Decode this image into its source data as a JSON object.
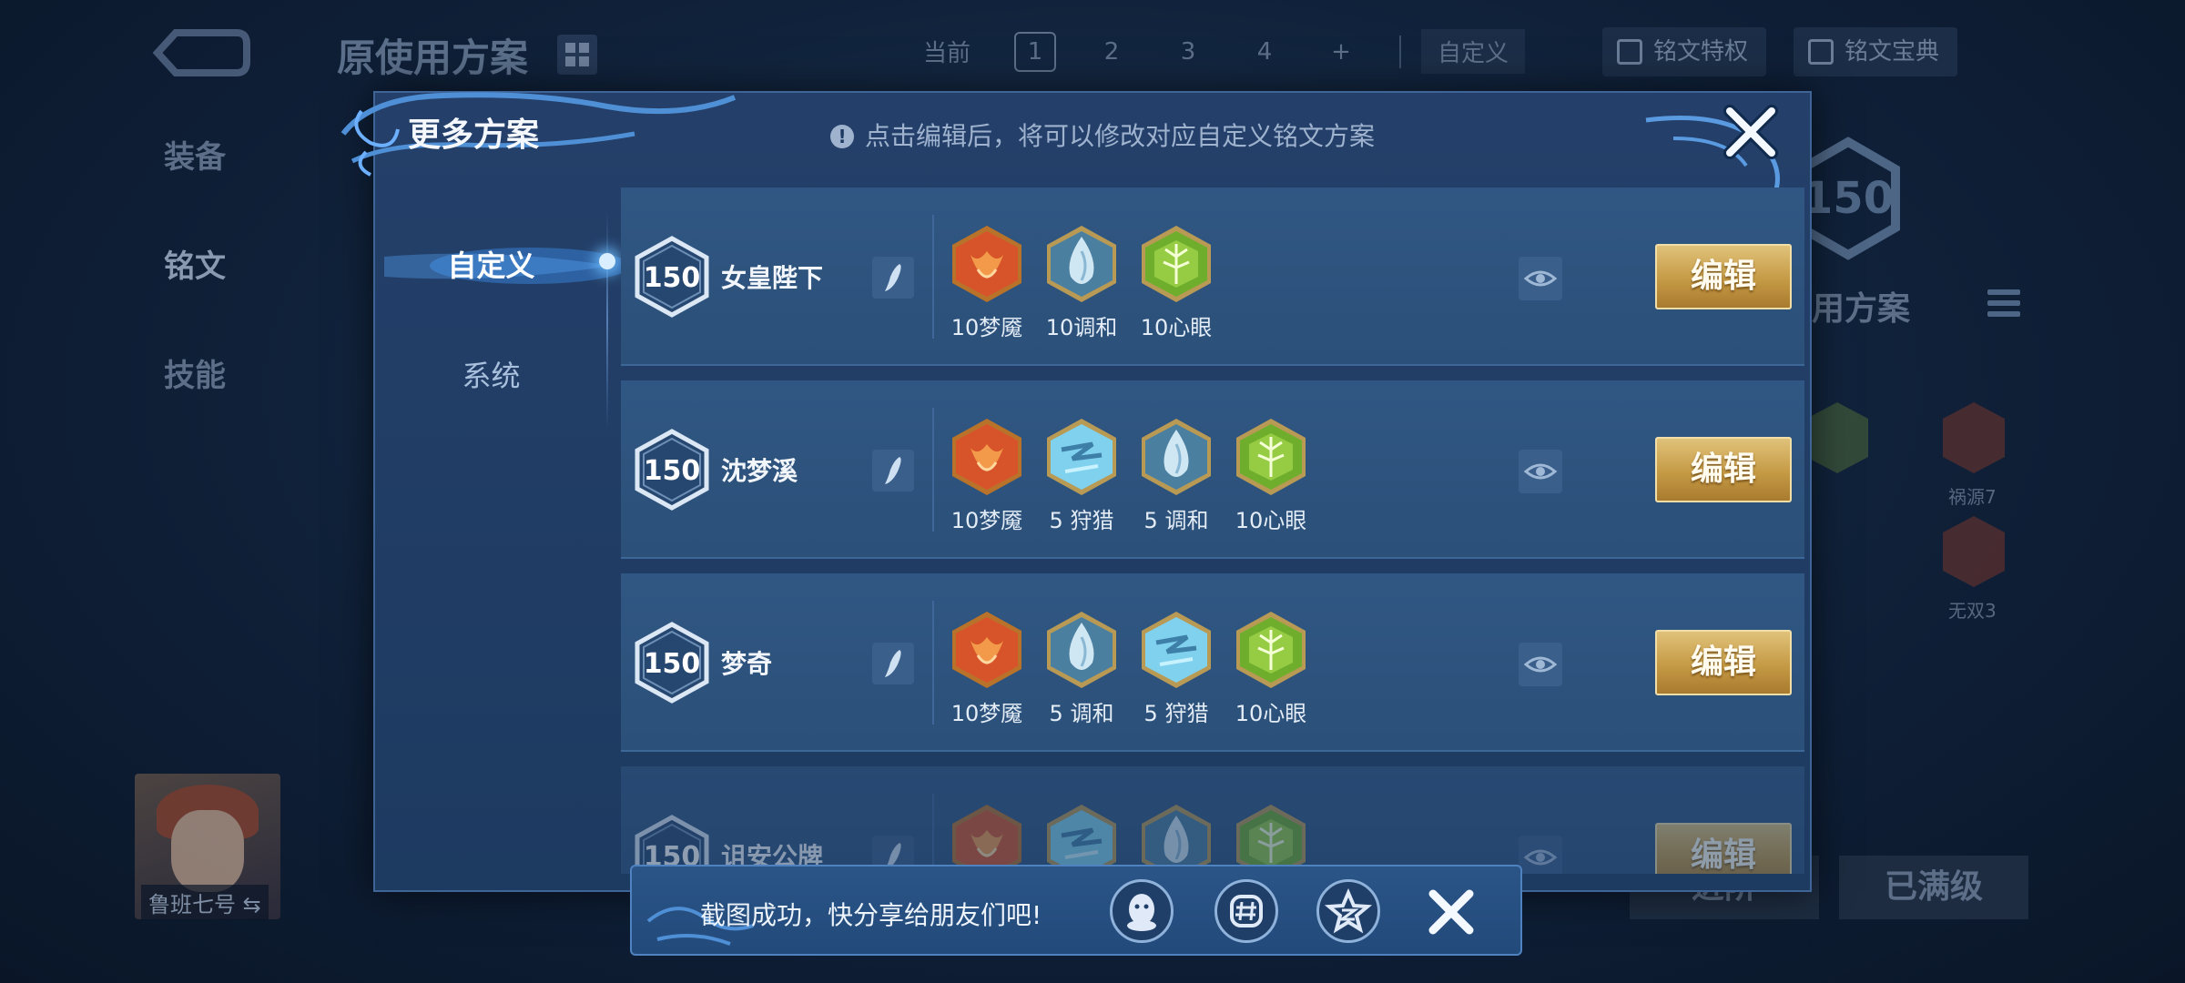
{
  "background": {
    "title": "原使用方案",
    "tabs": {
      "current_label": "当前",
      "pages": [
        "1",
        "2",
        "3",
        "4"
      ],
      "add": "+"
    },
    "custom_label": "自定义",
    "features": [
      "铭文特权",
      "铭文宝典"
    ],
    "side_nav": [
      "装备",
      "铭文",
      "技能"
    ],
    "badge_level": "150",
    "using_label": "用方案",
    "rune_labels": [
      "祸源7",
      "无双3"
    ],
    "hero_name": "鲁班七号 ⇆",
    "buttons": [
      "进阶",
      "已满级"
    ]
  },
  "modal": {
    "title": "更多方案",
    "hint": "点击编辑后，将可以修改对应自定义铭文方案",
    "tabs": {
      "custom": "自定义",
      "system": "系统"
    },
    "rows": [
      {
        "level": "150",
        "name": "女皇陛下",
        "edit_label": "编辑",
        "runes": [
          {
            "type": "red",
            "label": "10梦魇"
          },
          {
            "type": "blue",
            "label": "10调和"
          },
          {
            "type": "green",
            "label": "10心眼"
          }
        ]
      },
      {
        "level": "150",
        "name": "沈梦溪",
        "edit_label": "编辑",
        "runes": [
          {
            "type": "red",
            "label": "10梦魇"
          },
          {
            "type": "cyan",
            "label": "5 狩猎"
          },
          {
            "type": "blue",
            "label": "5 调和"
          },
          {
            "type": "green",
            "label": "10心眼"
          }
        ]
      },
      {
        "level": "150",
        "name": "梦奇",
        "edit_label": "编辑",
        "runes": [
          {
            "type": "red",
            "label": "10梦魇"
          },
          {
            "type": "blue",
            "label": "5 调和"
          },
          {
            "type": "cyan",
            "label": "5 狩猎"
          },
          {
            "type": "green",
            "label": "10心眼"
          }
        ]
      },
      {
        "level": "150",
        "name": "诅安公牌",
        "edit_label": "编辑",
        "runes": [
          {
            "type": "red",
            "label": ""
          },
          {
            "type": "cyan",
            "label": ""
          },
          {
            "type": "blue",
            "label": ""
          },
          {
            "type": "green",
            "label": ""
          }
        ]
      }
    ]
  },
  "toast": {
    "text": "截图成功，快分享给朋友们吧!",
    "share_targets": [
      "qq-icon",
      "moments-icon",
      "qzone-icon"
    ]
  },
  "colors": {
    "rune_red": "#d7542a",
    "rune_blue": "#cfe6f3",
    "rune_cyan": "#7fd1ee",
    "rune_green": "#8fcc3c",
    "gold_button": "#c59a45"
  }
}
